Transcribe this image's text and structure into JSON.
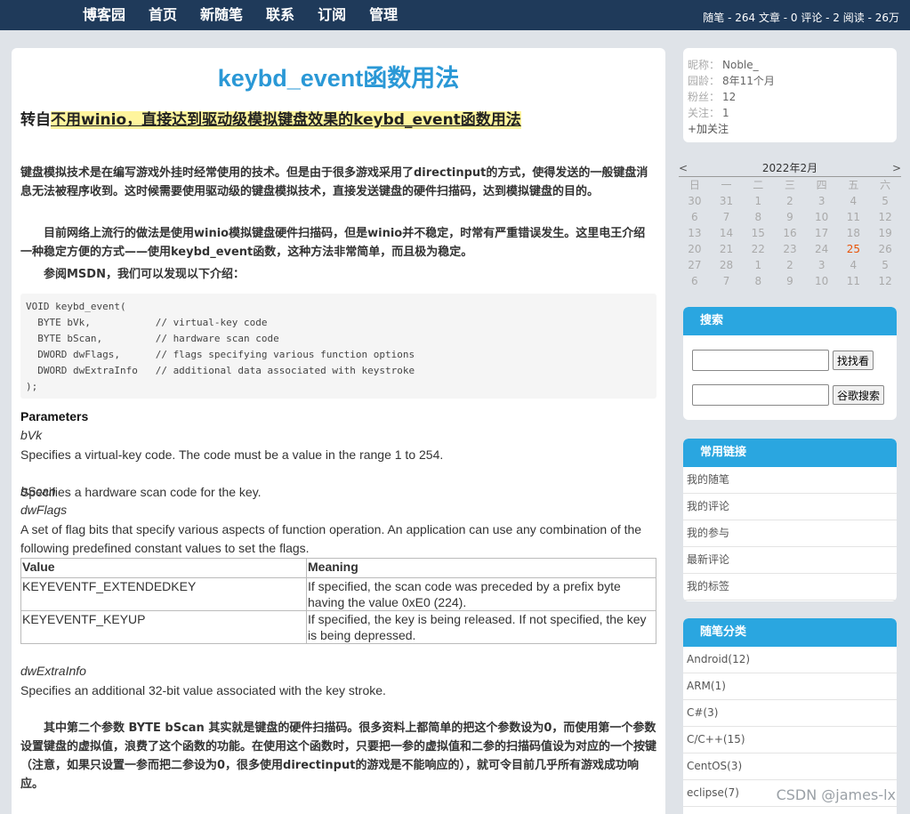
{
  "nav": {
    "items": [
      "博客园",
      "首页",
      "新随笔",
      "联系",
      "订阅",
      "管理"
    ],
    "stats": "随笔 - 264  文章 - 0  评论 - 2  阅读 - 26万"
  },
  "post": {
    "title": "keybd_event函数用法",
    "subtitle_prefix": "转自",
    "subtitle_link": "不用winio，直接达到驱动级模拟键盘效果的keybd_event函数用法",
    "para1": "键盘模拟技术是在编写游戏外挂时经常使用的技术。但是由于很多游戏采用了directinput的方式，使得发送的一般键盘消息无法被程序收到。这时候需要使用驱动级的键盘模拟技术，直接发送键盘的硬件扫描码，达到模拟键盘的目的。",
    "para2": "　　目前网络上流行的做法是使用winio模拟键盘硬件扫描码，但是winio并不稳定，时常有严重错误发生。这里电王介绍一种稳定方便的方式——使用keybd_event函数，这种方法非常简单，而且极为稳定。",
    "para3": "　　参阅MSDN，我们可以发现以下介绍：",
    "code": "VOID keybd_event(\n  BYTE bVk,           // virtual-key code\n  BYTE bScan,         // hardware scan code\n  DWORD dwFlags,      // flags specifying various function options\n  DWORD dwExtraInfo   // additional data associated with keystroke\n);",
    "parameters_heading": "Parameters",
    "params": [
      {
        "name": "bVk",
        "desc": "Specifies a virtual-key code. The code must be a value in the range 1 to 254."
      },
      {
        "name": "bScan",
        "desc": "Specifies a hardware scan code for the key."
      },
      {
        "name": "dwFlags",
        "desc": "A set of flag bits that specify various aspects of function operation. An application can use any combination of the following predefined constant values to set the flags."
      }
    ],
    "table": {
      "headers": [
        "Value",
        "Meaning"
      ],
      "rows": [
        [
          "KEYEVENTF_EXTENDEDKEY",
          "If specified, the scan code was preceded by a prefix byte having the value 0xE0 (224)."
        ],
        [
          "KEYEVENTF_KEYUP",
          "If specified, the key is being released. If not specified, the key is being depressed."
        ]
      ]
    },
    "extra_name": "dwExtraInfo",
    "extra_desc": "Specifies an additional 32-bit value associated with the key stroke.",
    "para4": "　　其中第二个参数 BYTE bScan 其实就是键盘的硬件扫描码。很多资料上都简单的把这个参数设为0，而使用第一个参数设置键盘的虚拟值，浪费了这个函数的功能。在使用这个函数时，只要把一参的虚拟值和二参的扫描码值设为对应的一个按键（注意，如果只设置一参而把二参设为0，很多使用directinput的游戏是不能响应的），就可令目前几乎所有游戏成功响应。"
  },
  "profile": {
    "nick_label": "昵称：",
    "nick": "Noble_",
    "age_label": "园龄：",
    "age": "8年11个月",
    "fans_label": "粉丝：",
    "fans": "12",
    "follow_label": "关注：",
    "follow": "1",
    "add_follow": "+加关注"
  },
  "calendar": {
    "prev": "<",
    "next": ">",
    "month": "2022年2月",
    "weekdays": [
      "日",
      "一",
      "二",
      "三",
      "四",
      "五",
      "六"
    ],
    "weeks": [
      [
        "30",
        "31",
        "1",
        "2",
        "3",
        "4",
        "5"
      ],
      [
        "6",
        "7",
        "8",
        "9",
        "10",
        "11",
        "12"
      ],
      [
        "13",
        "14",
        "15",
        "16",
        "17",
        "18",
        "19"
      ],
      [
        "20",
        "21",
        "22",
        "23",
        "24",
        "25",
        "26"
      ],
      [
        "27",
        "28",
        "1",
        "2",
        "3",
        "4",
        "5"
      ],
      [
        "6",
        "7",
        "8",
        "9",
        "10",
        "11",
        "12"
      ]
    ],
    "today": "25"
  },
  "search": {
    "title": "搜索",
    "btn1": "找找看",
    "btn2": "谷歌搜索"
  },
  "links": {
    "title": "常用链接",
    "items": [
      "我的随笔",
      "我的评论",
      "我的参与",
      "最新评论",
      "我的标签"
    ]
  },
  "categories": {
    "title": "随笔分类",
    "items": [
      "Android(12)",
      "ARM(1)",
      "C#(3)",
      "C/C++(15)",
      "CentOS(3)",
      "eclipse(7)"
    ]
  },
  "watermark": "CSDN @james-lx"
}
